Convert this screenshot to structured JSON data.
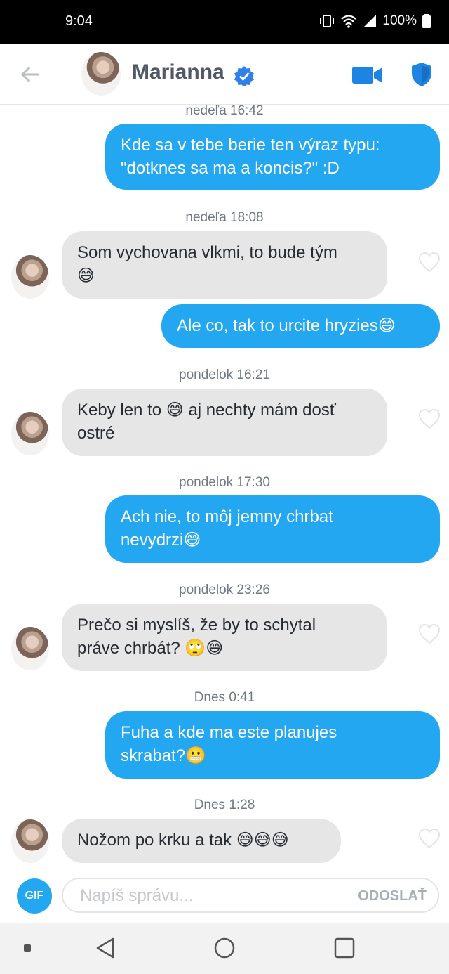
{
  "status_bar": {
    "time": "9:04",
    "battery": "100%",
    "icons": [
      "vibrate-icon",
      "wifi-icon",
      "signal-icon",
      "battery-icon"
    ]
  },
  "header": {
    "contact_name": "Marianna",
    "icons": [
      "back-icon",
      "verified-badge-icon",
      "video-call-icon",
      "safety-shield-icon"
    ],
    "accent_color": "#22a7f0"
  },
  "messages": [
    {
      "type": "timestamp",
      "text": "nedeľa 16:42"
    },
    {
      "type": "out",
      "lines": [
        "Kde sa v tebe berie ten výraz typu:",
        "\"dotknes sa ma a koncis?\" :D"
      ]
    },
    {
      "type": "timestamp",
      "text": "nedeľa 18:08"
    },
    {
      "type": "in",
      "lines": [
        "Som vychovana vlkmi, to bude tým",
        "😅"
      ]
    },
    {
      "type": "out",
      "lines": [
        "Ale co, tak to urcite hryzies😄"
      ]
    },
    {
      "type": "timestamp",
      "text": "pondelok 16:21"
    },
    {
      "type": "in",
      "lines": [
        "Keby len to 😅 aj nechty mám dosť",
        "ostré"
      ]
    },
    {
      "type": "timestamp",
      "text": "pondelok 17:30"
    },
    {
      "type": "out",
      "lines": [
        "Ach nie, to môj jemny chrbat",
        "nevydrzi😅"
      ]
    },
    {
      "type": "timestamp",
      "text": "pondelok 23:26"
    },
    {
      "type": "in",
      "lines": [
        "Prečo si myslíš, že by to schytal",
        "práve chrbát? 🙄😅"
      ]
    },
    {
      "type": "timestamp",
      "text": "Dnes 0:41"
    },
    {
      "type": "out",
      "lines": [
        "Fuha a kde ma este planujes",
        "skrabat?😬"
      ]
    },
    {
      "type": "timestamp",
      "text": "Dnes 1:28"
    },
    {
      "type": "in",
      "lines": [
        "Nožom po krku a tak 😅😅😅"
      ]
    }
  ],
  "composer": {
    "gif_label": "GIF",
    "placeholder": "Napíš správu...",
    "send_label": "ODOSLAŤ"
  },
  "navbar": {
    "icons": [
      "recents-dot-icon",
      "back-triangle-icon",
      "home-circle-icon",
      "overview-square-icon"
    ]
  },
  "colors": {
    "outgoing_bubble": "#22a7f0",
    "incoming_bubble": "#e6e6e6",
    "timestamp_text": "#6f7884"
  }
}
